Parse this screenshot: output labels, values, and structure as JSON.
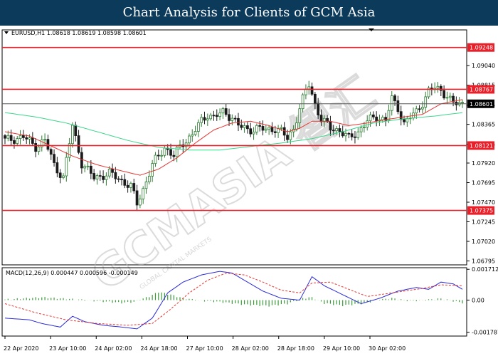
{
  "banner": {
    "title": "Chart Analysis for Clients of GCM Asia"
  },
  "colors": {
    "banner_bg": "#0c3a5b",
    "bull": "#2e7d32",
    "bear": "#1b1b1b",
    "ma_fast": "#e53935",
    "ma_slow": "#3cd68a",
    "level_line": "#e8202a",
    "level_tag_bg": "#e8202a",
    "price_tag_bg": "#000000",
    "macd_hist": "#3a9a3a",
    "macd_line": "#2c2cd8",
    "signal_line": "#e53935"
  },
  "chart_data": [
    {
      "type": "candlestick",
      "symbol_label": "EURUSD,H1",
      "ohlc_label": [
        "1.08618",
        "1.08619",
        "1.08598",
        "1.08601"
      ],
      "ylim": [
        1.0675,
        1.0945
      ],
      "y_ticks": [
        "1.09040",
        "1.08815",
        "1.08585",
        "1.08365",
        "1.08135",
        "1.07920",
        "1.07695",
        "1.07470",
        "1.07245",
        "1.07020",
        "1.06795"
      ],
      "x_labels": [
        "22 Apr 2020",
        "23 Apr 10:00",
        "24 Apr 02:00",
        "24 Apr 18:00",
        "27 Apr 10:00",
        "28 Apr 02:00",
        "28 Apr 18:00",
        "29 Apr 10:00",
        "30 Apr 02:00"
      ],
      "levels": [
        {
          "value": 1.09248,
          "label": "1.09248"
        },
        {
          "value": 1.08767,
          "label": "1.08767"
        },
        {
          "value": 1.08121,
          "label": "1.08121"
        },
        {
          "value": 1.07375,
          "label": "1.07375"
        }
      ],
      "current_price": {
        "value": 1.08601,
        "label": "1.08601"
      },
      "close_path": [
        [
          0,
          1.0818
        ],
        [
          6,
          1.0822
        ],
        [
          10,
          1.0811
        ],
        [
          13,
          1.0818
        ],
        [
          16,
          1.079
        ],
        [
          19,
          1.0775
        ],
        [
          22,
          1.0835
        ],
        [
          25,
          1.0792
        ],
        [
          29,
          1.0775
        ],
        [
          34,
          1.078
        ],
        [
          38,
          1.0772
        ],
        [
          41,
          1.0765
        ],
        [
          43,
          1.0745
        ],
        [
          45,
          1.0762
        ],
        [
          48,
          1.079
        ],
        [
          52,
          1.081
        ],
        [
          55,
          1.08
        ],
        [
          58,
          1.0815
        ],
        [
          61,
          1.0825
        ],
        [
          64,
          1.084
        ],
        [
          66,
          1.0848
        ],
        [
          68,
          1.0845
        ],
        [
          71,
          1.085
        ],
        [
          74,
          1.0845
        ],
        [
          76,
          1.0835
        ],
        [
          79,
          1.083
        ],
        [
          82,
          1.0832
        ],
        [
          85,
          1.083
        ],
        [
          88,
          1.0832
        ],
        [
          90,
          1.0828
        ],
        [
          92,
          1.082
        ],
        [
          94,
          1.0832
        ],
        [
          96,
          1.0855
        ],
        [
          98,
          1.0875
        ],
        [
          99,
          1.0882
        ],
        [
          101,
          1.086
        ],
        [
          103,
          1.0842
        ],
        [
          106,
          1.0832
        ],
        [
          109,
          1.083
        ],
        [
          112,
          1.082
        ],
        [
          115,
          1.0828
        ],
        [
          118,
          1.084
        ],
        [
          121,
          1.0845
        ],
        [
          124,
          1.0842
        ],
        [
          126,
          1.0865
        ],
        [
          128,
          1.0855
        ],
        [
          130,
          1.0838
        ],
        [
          132,
          1.0845
        ],
        [
          134,
          1.085
        ],
        [
          136,
          1.0862
        ],
        [
          138,
          1.0875
        ],
        [
          140,
          1.0878
        ],
        [
          142,
          1.0875
        ],
        [
          144,
          1.087
        ],
        [
          146,
          1.086
        ],
        [
          149,
          1.086
        ]
      ],
      "ma_fast_path": [
        [
          0,
          1.0828
        ],
        [
          8,
          1.0823
        ],
        [
          16,
          1.081
        ],
        [
          22,
          1.08
        ],
        [
          30,
          1.079
        ],
        [
          38,
          1.0783
        ],
        [
          44,
          1.0778
        ],
        [
          50,
          1.0785
        ],
        [
          56,
          1.0798
        ],
        [
          62,
          1.0815
        ],
        [
          68,
          1.083
        ],
        [
          74,
          1.0838
        ],
        [
          80,
          1.084
        ],
        [
          86,
          1.0835
        ],
        [
          92,
          1.0828
        ],
        [
          96,
          1.0832
        ],
        [
          100,
          1.084
        ],
        [
          106,
          1.084
        ],
        [
          112,
          1.0835
        ],
        [
          118,
          1.0838
        ],
        [
          124,
          1.0842
        ],
        [
          130,
          1.0845
        ],
        [
          136,
          1.0848
        ],
        [
          142,
          1.086
        ],
        [
          149,
          1.0865
        ]
      ],
      "ma_slow_path": [
        [
          0,
          1.085
        ],
        [
          10,
          1.0845
        ],
        [
          20,
          1.0838
        ],
        [
          30,
          1.0828
        ],
        [
          40,
          1.0818
        ],
        [
          50,
          1.081
        ],
        [
          60,
          1.0807
        ],
        [
          70,
          1.0807
        ],
        [
          80,
          1.0811
        ],
        [
          90,
          1.0815
        ],
        [
          100,
          1.082
        ],
        [
          110,
          1.0828
        ],
        [
          120,
          1.0838
        ],
        [
          130,
          1.0843
        ],
        [
          140,
          1.0846
        ],
        [
          149,
          1.085
        ]
      ]
    },
    {
      "type": "macd",
      "label": "MACD(12,26,9) 0.000447 0.000596 -0.000149",
      "ylim": [
        -0.002,
        0.0018
      ],
      "y_ticks": [
        {
          "value": 0.001712,
          "label": "0.001712"
        },
        {
          "value": 0.0,
          "label": "0.00"
        },
        {
          "value": -0.001787,
          "label": "-0.001787"
        }
      ],
      "hist_path": [
        [
          0,
          3e-05
        ],
        [
          12,
          0.00015
        ],
        [
          22,
          5e-05
        ],
        [
          30,
          -5e-05
        ],
        [
          38,
          -0.00015
        ],
        [
          42,
          -0.0001
        ],
        [
          47,
          0.0002
        ],
        [
          50,
          0.00045
        ],
        [
          54,
          0.0003
        ],
        [
          58,
          0.0001
        ],
        [
          64,
          -3e-05
        ],
        [
          70,
          -0.0001
        ],
        [
          78,
          -0.00025
        ],
        [
          86,
          -0.00032
        ],
        [
          92,
          -0.0002
        ],
        [
          97,
          0.0001
        ],
        [
          100,
          0.00015
        ],
        [
          104,
          -0.00018
        ],
        [
          110,
          -0.0003
        ],
        [
          116,
          -0.0002
        ],
        [
          122,
          2e-05
        ],
        [
          126,
          0.0001
        ],
        [
          132,
          -5e-05
        ],
        [
          138,
          2e-05
        ],
        [
          142,
          8e-05
        ],
        [
          146,
          -5e-05
        ],
        [
          149,
          -0.00015
        ]
      ],
      "macd_path": [
        [
          0,
          -0.001
        ],
        [
          8,
          -0.0011
        ],
        [
          12,
          -0.0013
        ],
        [
          18,
          -0.0015
        ],
        [
          22,
          -0.0009
        ],
        [
          26,
          -0.0012
        ],
        [
          32,
          -0.0014
        ],
        [
          38,
          -0.0015
        ],
        [
          43,
          -0.0016
        ],
        [
          48,
          -0.001
        ],
        [
          53,
          0.0004
        ],
        [
          58,
          0.001
        ],
        [
          64,
          0.0014
        ],
        [
          70,
          0.0016
        ],
        [
          74,
          0.0015
        ],
        [
          78,
          0.0011
        ],
        [
          84,
          0.0005
        ],
        [
          90,
          0.0001
        ],
        [
          96,
          0.0
        ],
        [
          100,
          0.0013
        ],
        [
          104,
          0.0008
        ],
        [
          110,
          0.0003
        ],
        [
          116,
          -0.0002
        ],
        [
          122,
          0.0001
        ],
        [
          128,
          0.0005
        ],
        [
          134,
          0.0007
        ],
        [
          138,
          0.0006
        ],
        [
          142,
          0.001
        ],
        [
          146,
          0.0009
        ],
        [
          149,
          0.0006
        ]
      ],
      "signal_path": [
        [
          0,
          -0.0002
        ],
        [
          10,
          -0.0007
        ],
        [
          20,
          -0.0011
        ],
        [
          30,
          -0.0013
        ],
        [
          40,
          -0.0014
        ],
        [
          48,
          -0.0013
        ],
        [
          54,
          -0.0005
        ],
        [
          60,
          0.0004
        ],
        [
          66,
          0.0011
        ],
        [
          72,
          0.0015
        ],
        [
          78,
          0.0014
        ],
        [
          84,
          0.001
        ],
        [
          90,
          0.00055
        ],
        [
          96,
          0.0004
        ],
        [
          100,
          0.00095
        ],
        [
          106,
          0.001
        ],
        [
          112,
          0.0006
        ],
        [
          118,
          0.0002
        ],
        [
          124,
          0.00035
        ],
        [
          130,
          0.0005
        ],
        [
          136,
          0.00065
        ],
        [
          142,
          0.00085
        ],
        [
          149,
          0.0008
        ]
      ]
    }
  ],
  "watermark": {
    "main": "GCMASIA 智汇",
    "sub": "GLOBAL CAPITAL MARKETS"
  }
}
